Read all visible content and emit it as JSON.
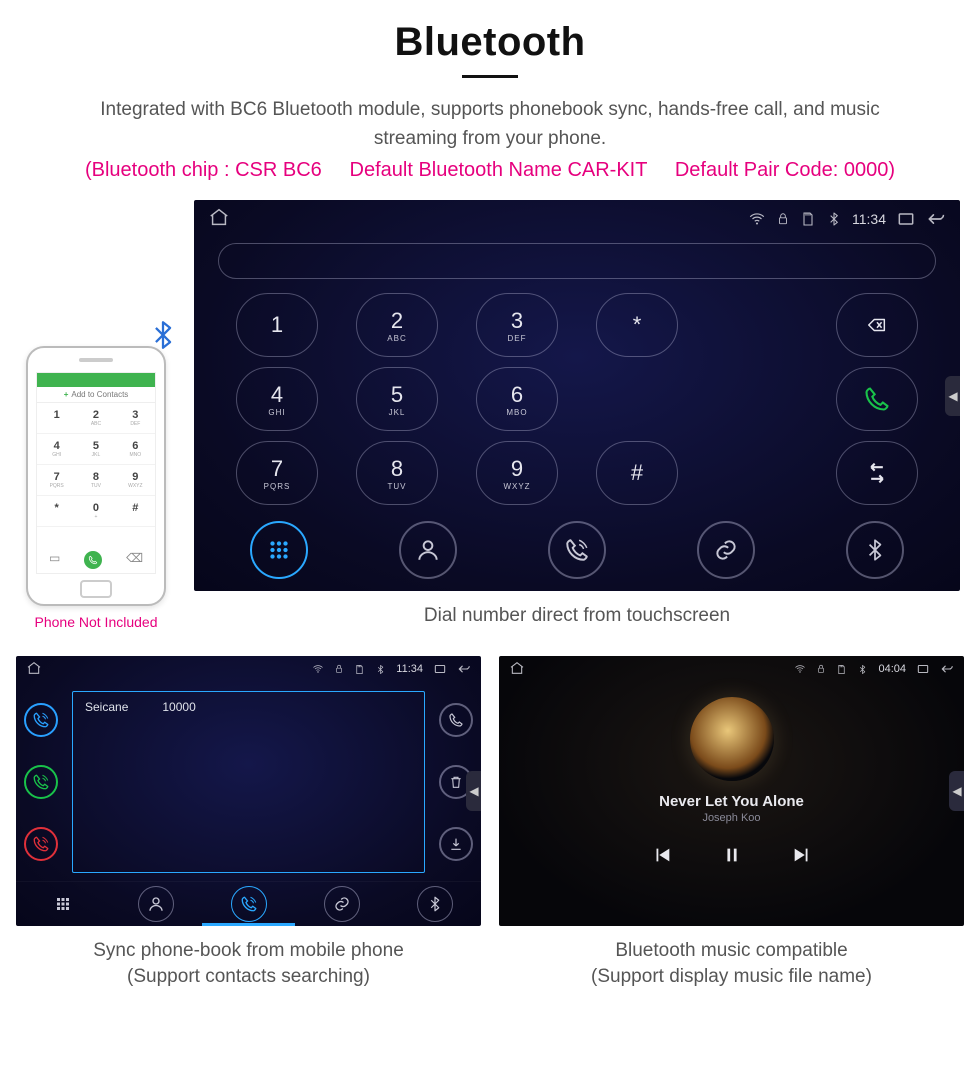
{
  "header": {
    "title": "Bluetooth",
    "subtitle": "Integrated with BC6 Bluetooth module, supports phonebook sync, hands-free call, and music streaming from your phone.",
    "pinkline": "(Bluetooth chip : CSR BC6     Default Bluetooth Name CAR-KIT     Default Pair Code: 0000)"
  },
  "phone_mock": {
    "addbar": "Add to Contacts",
    "caption": "Phone Not Included",
    "keys": [
      {
        "d": "1",
        "l": ""
      },
      {
        "d": "2",
        "l": "ABC"
      },
      {
        "d": "3",
        "l": "DEF"
      },
      {
        "d": "4",
        "l": "GHI"
      },
      {
        "d": "5",
        "l": "JKL"
      },
      {
        "d": "6",
        "l": "MNO"
      },
      {
        "d": "7",
        "l": "PQRS"
      },
      {
        "d": "8",
        "l": "TUV"
      },
      {
        "d": "9",
        "l": "WXYZ"
      },
      {
        "d": "*",
        "l": ""
      },
      {
        "d": "0",
        "l": "+"
      },
      {
        "d": "#",
        "l": ""
      }
    ]
  },
  "dialer": {
    "time": "11:34",
    "row1": [
      "1",
      "2",
      "3",
      "*"
    ],
    "row1_sub": [
      "",
      "ABC",
      "DEF",
      ""
    ],
    "row2": [
      "4",
      "5",
      "6"
    ],
    "row2_sub": [
      "GHI",
      "JKL",
      "MBO"
    ],
    "row3": [
      "7",
      "8",
      "9",
      "#"
    ],
    "row3_sub": [
      "PQRS",
      "TUV",
      "WXYZ",
      ""
    ],
    "caption": "Dial number direct from touchscreen"
  },
  "contacts": {
    "time": "11:34",
    "name": "Seicane",
    "number": "10000",
    "caption_l1": "Sync phone-book from mobile phone",
    "caption_l2": "(Support contacts searching)"
  },
  "music": {
    "time": "04:04",
    "track": "Never Let You Alone",
    "artist": "Joseph Koo",
    "caption_l1": "Bluetooth music compatible",
    "caption_l2": "(Support display music file name)"
  }
}
